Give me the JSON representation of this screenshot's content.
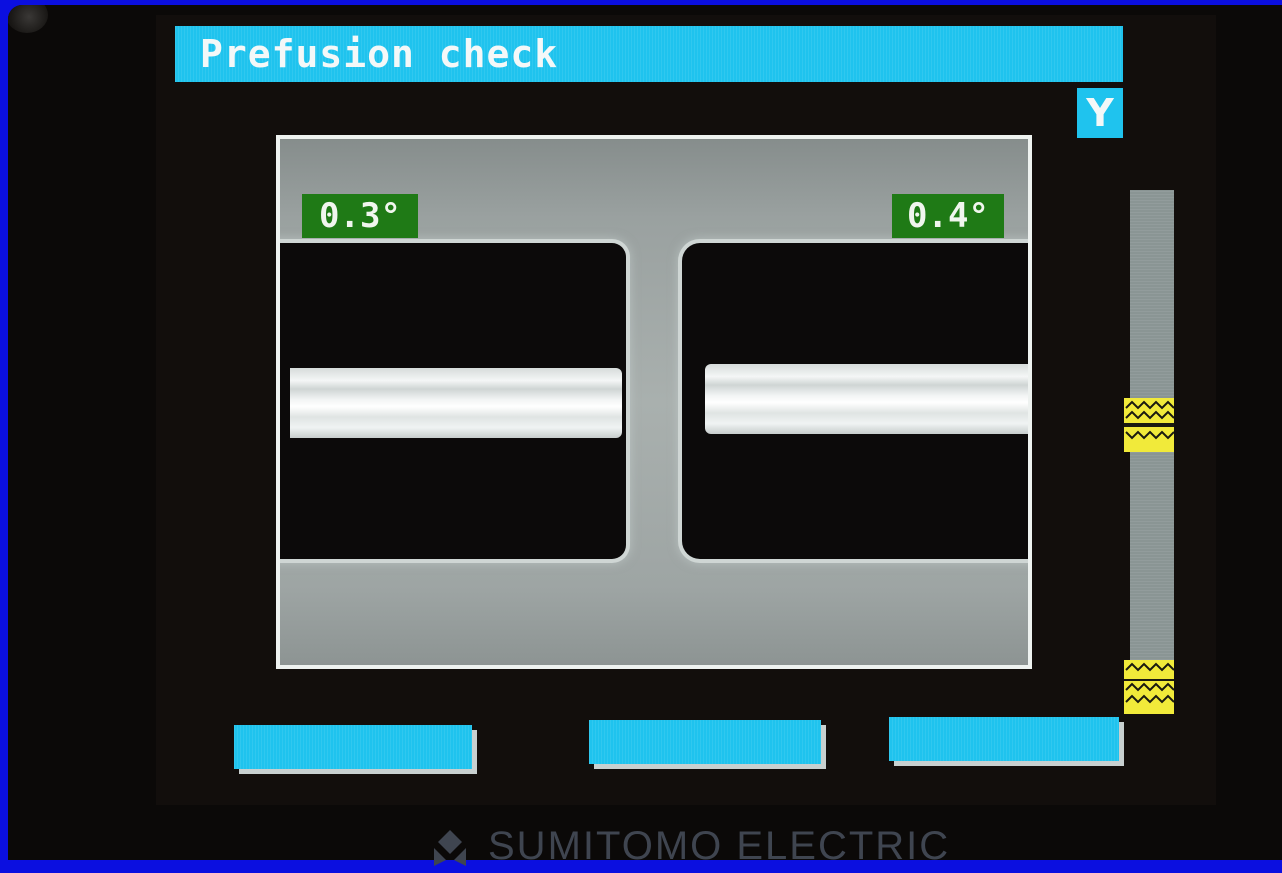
{
  "header": {
    "title": "Prefusion check",
    "axis_indicator": "Y"
  },
  "camera": {
    "left_cleave_angle": "0.3°",
    "right_cleave_angle": "0.4°"
  },
  "softkeys": [
    {
      "label": ""
    },
    {
      "label": ""
    },
    {
      "label": ""
    }
  ],
  "brand": {
    "name": "SUMITOMO ELECTRIC"
  },
  "colors": {
    "accent": "#1fc3ee",
    "angle_badge": "#1f7a16",
    "marker": "#f1ea3a",
    "background": "#0b0fe0"
  }
}
